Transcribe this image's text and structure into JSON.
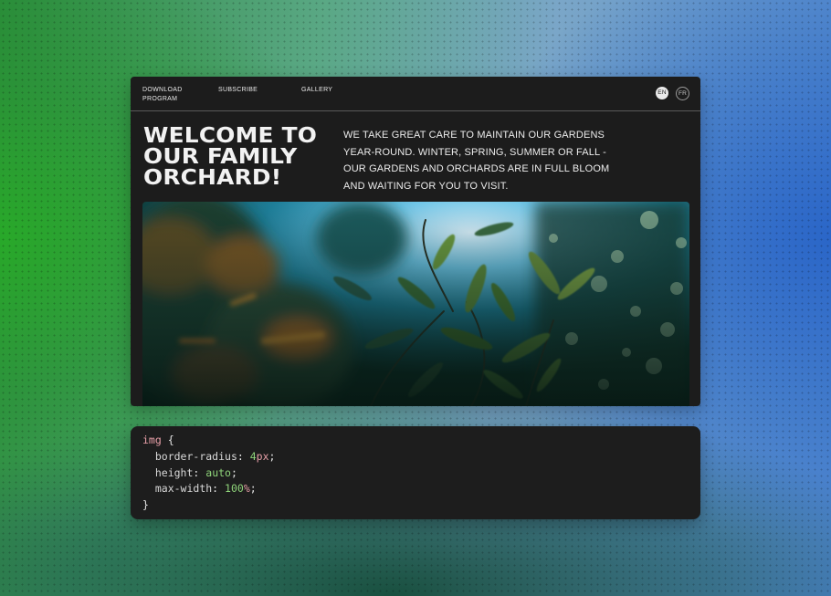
{
  "nav": {
    "links": [
      {
        "label": "DOWNLOAD\nPROGRAM"
      },
      {
        "label": "SUBSCRIBE"
      },
      {
        "label": "GALLERY"
      }
    ],
    "languages": [
      {
        "code": "EN",
        "active": true
      },
      {
        "code": "FR",
        "active": false
      }
    ]
  },
  "hero": {
    "headline_lines": [
      "WELCOME TO",
      "OUR FAMILY",
      "ORCHARD!"
    ],
    "intro_lines": [
      "WE TAKE GREAT CARE TO MAINTAIN OUR GARDENS",
      "YEAR-ROUND. WINTER, SPRING, SUMMER OR FALL -",
      "OUR GARDENS AND ORCHARDS ARE IN FULL BLOOM",
      "AND WAITING FOR YOU TO VISIT."
    ]
  },
  "code": {
    "selector": "img",
    "open_brace": "{",
    "close_brace": "}",
    "declarations": [
      {
        "property": "border-radius",
        "value": "4",
        "unit": "px"
      },
      {
        "property": "height",
        "value": "auto",
        "unit": ""
      },
      {
        "property": "max-width",
        "value": "100",
        "unit": "%"
      }
    ]
  },
  "colors": {
    "page_panel": "#1c1c1c",
    "code_selector": "#e8a0a8",
    "code_value": "#8fd47a"
  }
}
